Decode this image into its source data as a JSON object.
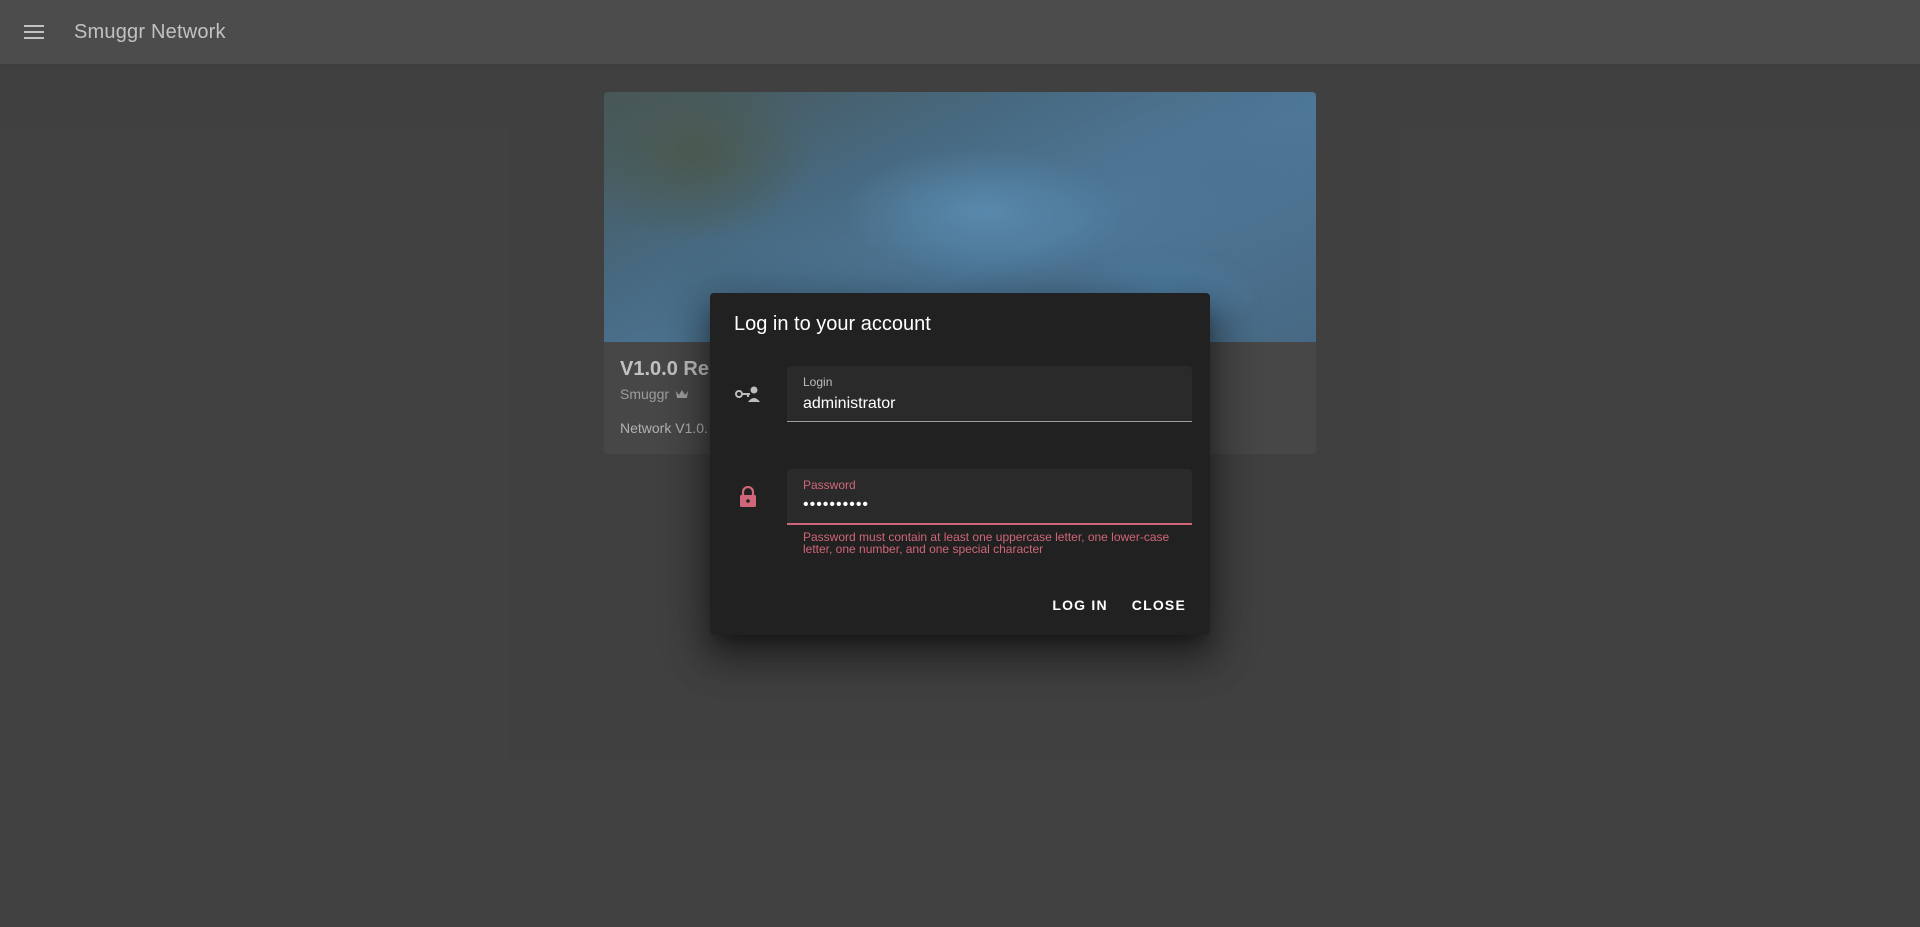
{
  "appbar": {
    "menu_icon": "menu-icon",
    "title": "Smuggr Network"
  },
  "card": {
    "title": "V1.0.0 Re",
    "author": "Smuggr",
    "author_badge_icon": "crown-icon",
    "text": "Network V1.0."
  },
  "dialog": {
    "title": "Log in to your account",
    "login": {
      "icon": "account-key-icon",
      "label": "Login",
      "value": "administrator"
    },
    "password": {
      "icon": "lock-icon",
      "label": "Password",
      "value": "••••••••••",
      "error": "Password must contain at least one uppercase letter, one lower-case letter, one number, and one special character"
    },
    "buttons": {
      "login": "LOG IN",
      "close": "CLOSE"
    }
  },
  "colors": {
    "error": "#cf6679",
    "appbar": "#272727",
    "dialog": "#212121"
  }
}
